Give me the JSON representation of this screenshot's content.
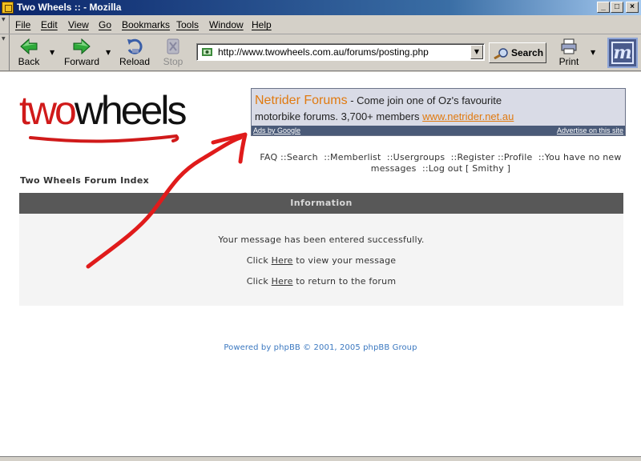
{
  "window": {
    "title": "Two Wheels :: - Mozilla",
    "controls": [
      "_",
      "□",
      "×"
    ]
  },
  "menu": {
    "items": [
      "File",
      "Edit",
      "View",
      "Go",
      "Bookmarks",
      "Tools",
      "Window",
      "Help"
    ]
  },
  "nav": {
    "back": "Back",
    "forward": "Forward",
    "reload": "Reload",
    "stop": "Stop",
    "url": "http://www.twowheels.com.au/forums/posting.php",
    "search": "Search",
    "print": "Print"
  },
  "logo": {
    "two": "two",
    "wheels": "wheels"
  },
  "ad": {
    "title": "Netrider Forums",
    "line1_rest": " - Come join one of Oz's favourite",
    "line2_text": "motorbike forums. 3,700+ members ",
    "line2_url": "www.netrider.net.au",
    "ads_by": "Ads by Google",
    "advertise": "Advertise on this site"
  },
  "toplinks": {
    "faq": "FAQ",
    "search": "::Search",
    "memberlist": "::Memberlist",
    "usergroups": "::Usergroups",
    "register": "::Register",
    "profile": "::Profile",
    "messages": "::You have no new messages",
    "logout": "::Log out [ Smithy ]"
  },
  "forum_index": "Two Wheels Forum Index",
  "info": {
    "header": "Information",
    "message": "Your message has been entered successfully.",
    "view_prefix": "Click ",
    "view_link": "Here",
    "view_suffix": " to view your message",
    "return_prefix": "Click ",
    "return_link": "Here",
    "return_suffix": " to return to the forum"
  },
  "footer": {
    "powered": "Powered by phpBB © 2001, 2005 phpBB Group"
  },
  "colors": {
    "logo_red": "#d01a1a",
    "ad_title": "#e07a10",
    "info_header": "#585858",
    "footer_link": "#3b78c0",
    "annotation_arrow": "#e01b1b"
  }
}
